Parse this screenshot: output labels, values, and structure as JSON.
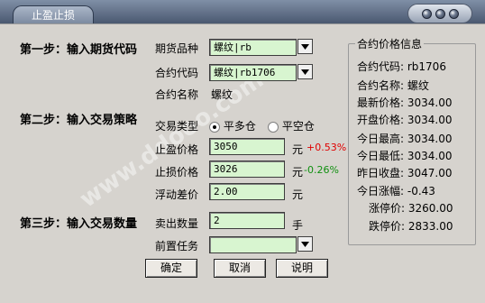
{
  "window": {
    "title": "止盈止损"
  },
  "step1": {
    "heading": "第一步：输入期货代码",
    "variety_label": "期货品种",
    "variety_value": "螺纹|rb",
    "code_label": "合约代码",
    "code_value": "螺纹|rb1706",
    "name_label": "合约名称",
    "name_value": "螺纹"
  },
  "step2": {
    "heading": "第二步：输入交易策略",
    "trade_type_label": "交易类型",
    "radio_close_long": "平多仓",
    "radio_close_short": "平空仓",
    "selected": "平多仓",
    "take_profit_label": "止盈价格",
    "take_profit_value": "3050",
    "take_profit_unit": "元",
    "take_profit_pct": "+0.53%",
    "stop_loss_label": "止损价格",
    "stop_loss_value": "3026",
    "stop_loss_unit": "元",
    "stop_loss_pct": "-0.26%",
    "float_label": "浮动差价",
    "float_value": "2.00",
    "float_unit": "元"
  },
  "step3": {
    "heading": "第三步：输入交易数量",
    "sell_qty_label": "卖出数量",
    "sell_qty_value": "2",
    "sell_qty_unit": "手",
    "pre_task_label": "前置任务",
    "pre_task_value": ""
  },
  "contract_info": {
    "title": "合约价格信息",
    "rows": [
      "合约代码: rb1706",
      "合约名称: 螺纹",
      "最新价格: 3034.00",
      "开盘价格: 3034.00",
      "今日最高: 3034.00",
      "今日最低: 3034.00",
      "昨日收盘: 3047.00",
      "今日涨幅: -0.43",
      "涨停价: 3260.00",
      "跌停价: 2833.00"
    ]
  },
  "buttons": {
    "ok": "确定",
    "cancel": "取消",
    "help": "说明"
  },
  "watermark": "www.ddooo.com"
}
